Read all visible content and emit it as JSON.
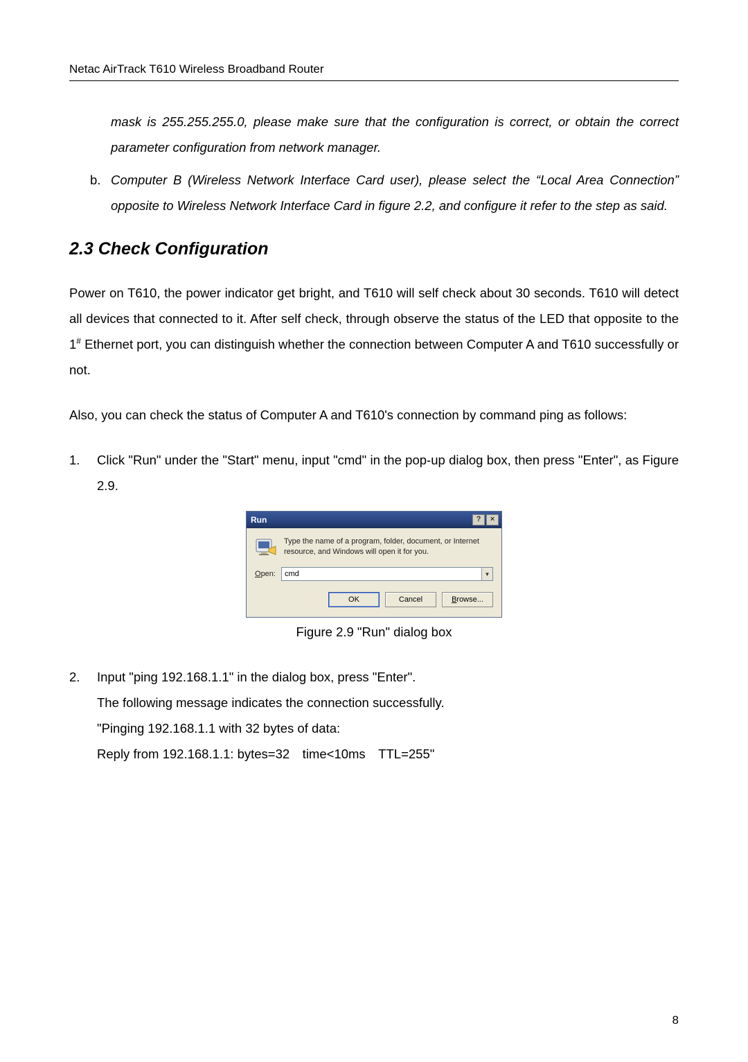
{
  "header": {
    "title": "Netac AirTrack T610 Wireless Broadband Router"
  },
  "intro": {
    "continued_para": "mask is 255.255.255.0, please make sure that the configuration is correct, or obtain the correct parameter configuration from network manager.",
    "item_b_marker": "b.",
    "item_b": "Computer B (Wireless Network Interface Card user), please select the “Local Area Connection” opposite to Wireless Network Interface Card in figure 2.2, and configure it refer to the step as said."
  },
  "section": {
    "heading": "2.3 Check Configuration"
  },
  "paras": {
    "p1_a": "Power on T610, the power indicator get bright, and T610 will self check about 30 seconds. T610 will detect all devices that connected to it. After self check, through observe the status of the LED that opposite to the 1",
    "p1_sup": "#",
    "p1_b": " Ethernet port, you can distinguish whether the connection between Computer A and T610 successfully or not.",
    "p2": "Also, you can check the status of Computer A and T610's connection by command ping as follows:"
  },
  "list": {
    "n1_marker": "1.",
    "n1_text": "Click \"Run\" under the \"Start\" menu, input \"cmd\" in the pop-up dialog box, then press \"Enter\", as Figure 2.9.",
    "n2_marker": "2.",
    "n2_line1": "Input \"ping 192.168.1.1\" in the dialog box, press \"Enter\".",
    "n2_line2": "The following message indicates the connection successfully.",
    "n2_line3": "\"Pinging 192.168.1.1 with 32 bytes of data:",
    "n2_line4": "Reply from 192.168.1.1: bytes=32 time<10ms TTL=255\""
  },
  "figure": {
    "caption": "Figure 2.9 \"Run\" dialog box"
  },
  "dialog": {
    "title": "Run",
    "help_btn": "?",
    "close_btn": "×",
    "description": "Type the name of a program, folder, document, or Internet resource, and Windows will open it for you.",
    "open_label_u": "O",
    "open_label_rest": "pen:",
    "input_value": "cmd",
    "ok": "OK",
    "cancel": "Cancel",
    "browse_u": "B",
    "browse_rest": "rowse..."
  },
  "page_number": "8"
}
